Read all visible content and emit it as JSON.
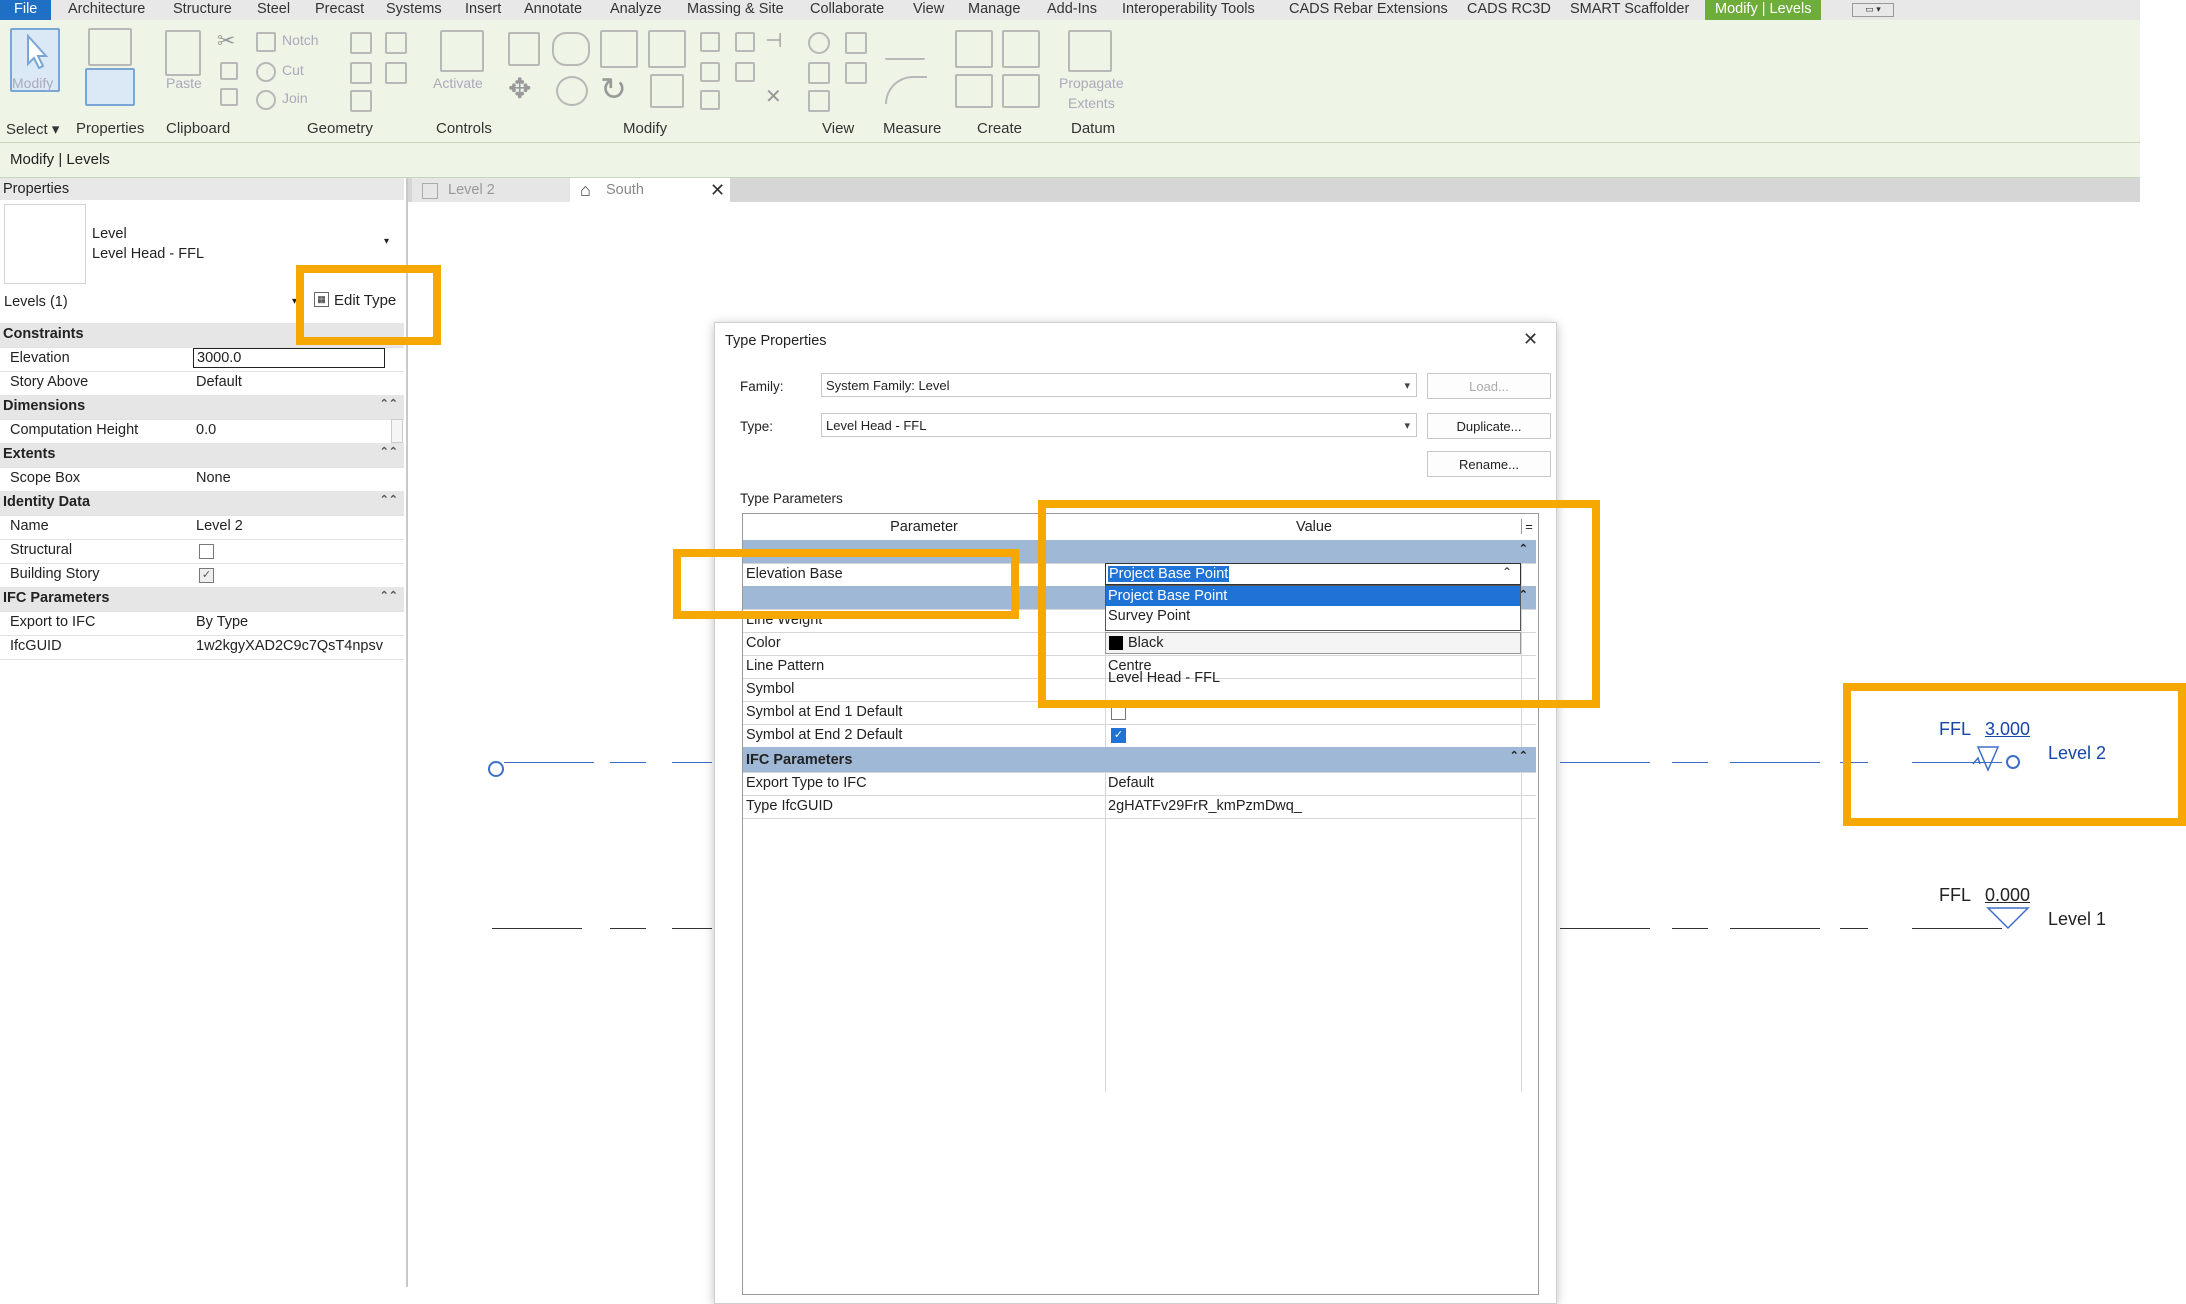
{
  "ribbon": {
    "tabs": [
      "File",
      "Architecture",
      "Structure",
      "Steel",
      "Precast",
      "Systems",
      "Insert",
      "Annotate",
      "Analyze",
      "Massing & Site",
      "Collaborate",
      "View",
      "Manage",
      "Add-Ins",
      "Interoperability Tools",
      "CADS Rebar Extensions",
      "CADS RC3D",
      "SMART Scaffolder",
      "Modify | Levels"
    ],
    "group_labels": [
      "Select",
      "Properties",
      "Clipboard",
      "Geometry",
      "Controls",
      "Modify",
      "View",
      "Measure",
      "Create",
      "Datum"
    ],
    "buttons": {
      "modify": "Modify",
      "paste": "Paste",
      "notch": "Notch",
      "cut": "Cut",
      "join": "Join",
      "activate": "Activate",
      "propagate": "Propagate",
      "extents": "Extents"
    }
  },
  "options_bar": {
    "context": "Modify | Levels"
  },
  "properties": {
    "title": "Properties",
    "type_name": "Level",
    "type_sub": "Level Head - FFL",
    "selection": "Levels (1)",
    "edit_type": "Edit Type",
    "rows": [
      {
        "section": "Constraints"
      },
      {
        "key": "Elevation",
        "value": "3000.0"
      },
      {
        "key": "Story Above",
        "value": "Default"
      },
      {
        "section": "Dimensions"
      },
      {
        "key": "Computation Height",
        "value": "0.0"
      },
      {
        "section": "Extents"
      },
      {
        "key": "Scope Box",
        "value": "None"
      },
      {
        "section": "Identity Data"
      },
      {
        "key": "Name",
        "value": "Level 2"
      },
      {
        "key": "Structural",
        "value": ""
      },
      {
        "key": "Building Story",
        "value": ""
      },
      {
        "section": "IFC Parameters"
      },
      {
        "key": "Export to IFC",
        "value": "By Type"
      },
      {
        "key": "IfcGUID",
        "value": "1w2kgyXAD2C9c7QsT4npsv"
      }
    ]
  },
  "view_tabs": [
    "Level 2",
    "South"
  ],
  "dialog": {
    "title": "Type Properties",
    "family_label": "Family:",
    "family_value": "System Family: Level",
    "type_label": "Type:",
    "type_value": "Level Head - FFL",
    "load": "Load...",
    "duplicate": "Duplicate...",
    "rename": "Rename...",
    "type_params": "Type Parameters",
    "col_param": "Parameter",
    "col_value": "Value",
    "col_eq": "=",
    "rows": [
      {
        "param": "Elevation Base",
        "value": "Project Base Point"
      },
      {
        "param": "Line Weight",
        "value": ""
      },
      {
        "param": "Color",
        "value": "Black"
      },
      {
        "param": "Line Pattern",
        "value": "Centre"
      },
      {
        "param": "Symbol",
        "value": "Level Head - FFL"
      },
      {
        "param": "Symbol at End 1 Default",
        "value": ""
      },
      {
        "param": "Symbol at End 2 Default",
        "value": ""
      }
    ],
    "ifc_section": "IFC Parameters",
    "ifc_rows": [
      {
        "param": "Export Type to IFC",
        "value": "Default"
      },
      {
        "param": "Type IfcGUID",
        "value": "2gHATFv29FrR_kmPzmDwq_"
      }
    ],
    "dropdown_options": [
      "Project Base Point",
      "Survey Point"
    ]
  },
  "drawing": {
    "level2": {
      "prefix": "FFL",
      "elev": "3.000",
      "name": "Level 2"
    },
    "level1": {
      "prefix": "FFL",
      "elev": "0.000",
      "name": "Level 1"
    }
  },
  "colors": {
    "highlight": "#f6a800",
    "selection": "#1f72d6",
    "datum": "#1546a8"
  }
}
